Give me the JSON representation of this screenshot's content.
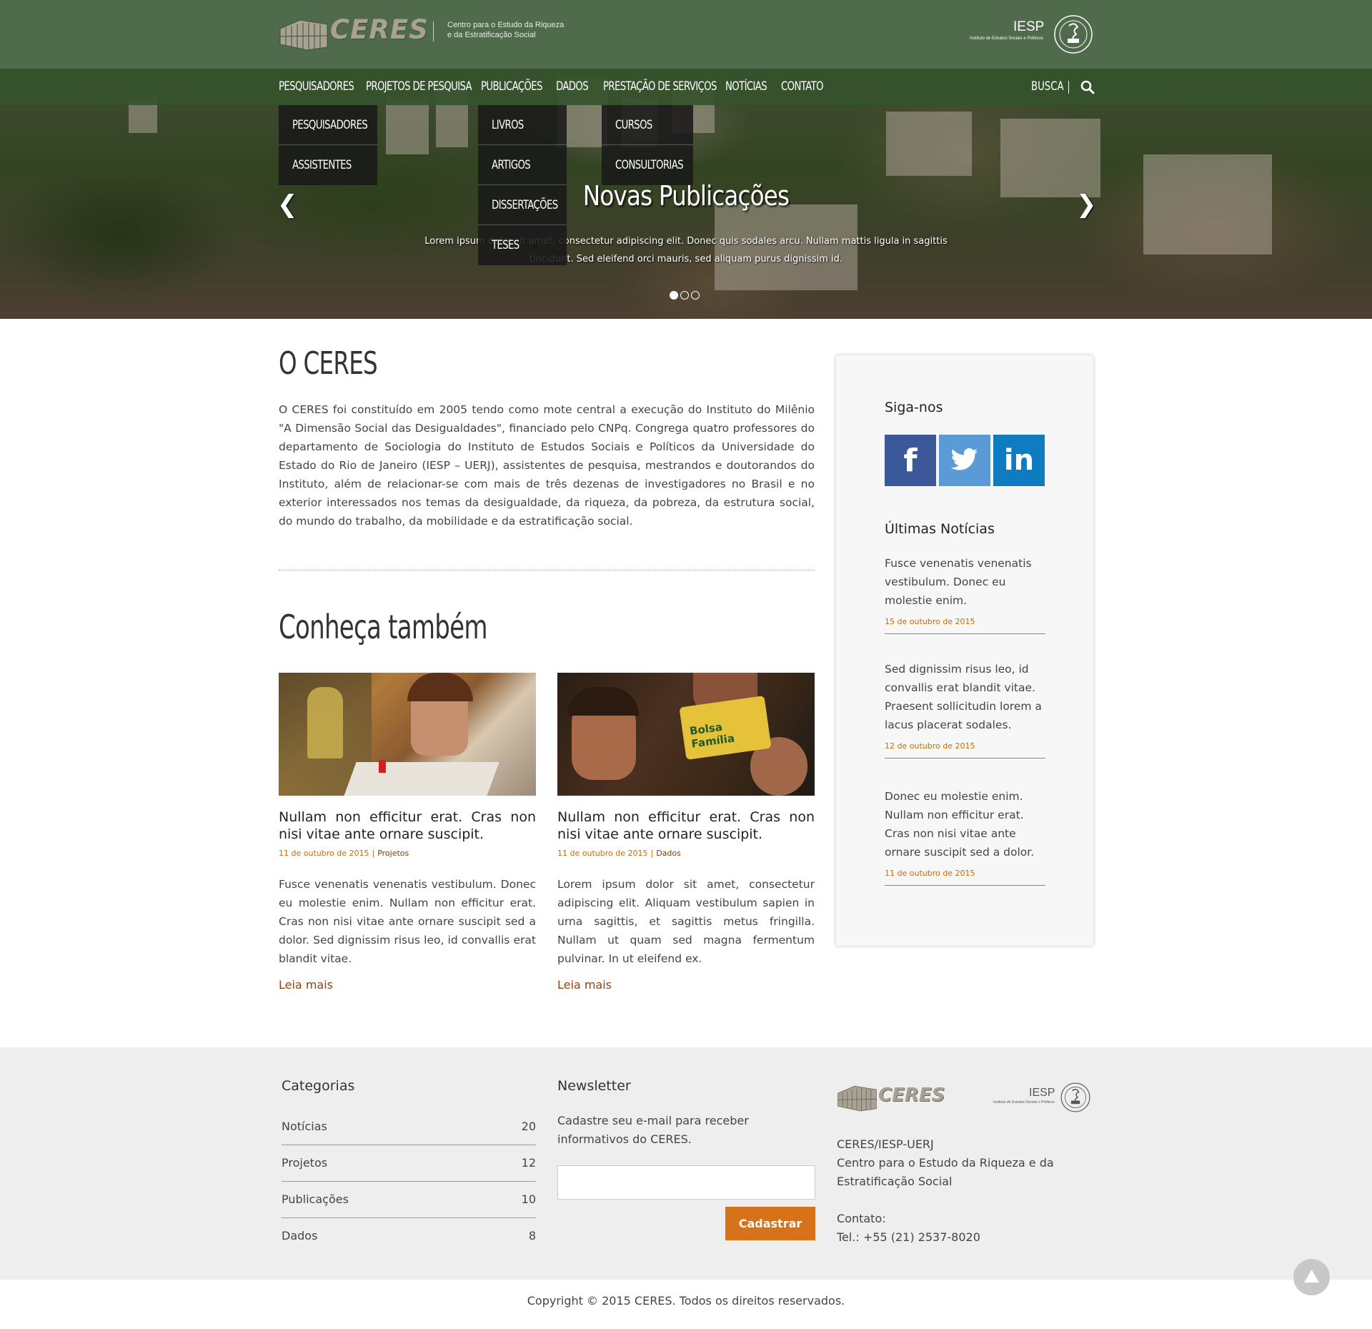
{
  "header": {
    "brand": "CERES",
    "tagline_line1": "Centro para o Estudo da Riqueza",
    "tagline_line2": "e da Estratificação Social",
    "partner_name": "IESP",
    "partner_sub": "Instituto de Estudos Sociais e Políticos"
  },
  "nav": {
    "items": [
      "PESQUISADORES",
      "PROJETOS DE PESQUISA",
      "PUBLICAÇÕES",
      "DADOS",
      "PRESTAÇÃO DE SERVIÇOS",
      "NOTÍCIAS",
      "CONTATO"
    ],
    "search_label": "BUSCA",
    "dropdowns": {
      "pesquisadores": [
        "PESQUISADORES",
        "ASSISTENTES"
      ],
      "publicacoes": [
        "LIVROS",
        "ARTIGOS",
        "DISSERTAÇÕES",
        "TESES"
      ],
      "servicos": [
        "CURSOS",
        "CONSULTORIAS"
      ]
    }
  },
  "hero": {
    "title": "Novas Publicações",
    "text": "Lorem ipsum dolor sit amet, consectetur adipiscing elit. Donec quis sodales arcu. Nullam mattis ligula in sagittis tincidunt. Sed eleifend orci mauris, sed aliquam purus dignissim id.",
    "slides": 3,
    "active_slide": 1
  },
  "about": {
    "title": "O CERES",
    "text": "O CERES foi constituído em 2005 tendo como mote central a execução do Instituto do Milênio \"A Dimensão Social das Desigualdades\", financiado pelo CNPq. Congrega quatro professores do departamento de Sociologia do Instituto de Estudos Sociais e Políticos da Universidade do Estado do Rio de Janeiro (IESP – UERJ), assistentes de pesquisa, mestrandos e doutorandos do Instituto, além de relacionar-se com mais de três dezenas de investigadores no Brasil e no exterior interessados nos temas da desigualdade, da riqueza, da pobreza, da estrutura social, do mundo do trabalho, da mobilidade e da estratificação social."
  },
  "related": {
    "title": "Conheça também",
    "cards": [
      {
        "title": "Nullam non efficitur erat. Cras non nisi vitae ante ornare suscipit.",
        "date": "11 de outubro de 2015",
        "category": "Projetos",
        "text": "Fusce venenatis venenatis vestibulum. Donec eu molestie enim. Nullam non efficitur erat. Cras non nisi vitae ante ornare suscipit sed a dolor. Sed dignissim risus leo, id convallis erat blandit vitae.",
        "link": "Leia mais"
      },
      {
        "title": "Nullam non efficitur erat. Cras non nisi vitae ante ornare suscipit.",
        "date": "11 de outubro de 2015",
        "category": "Dados",
        "text": "Lorem ipsum dolor sit amet, consectetur adipiscing elit. Aliquam vestibulum sapien in urna sagittis, et sagittis metus fringilla. Nullam ut quam sed magna fermentum pulvinar. In ut eleifend ex.",
        "link": "Leia mais",
        "card_text": "Bolsa Família"
      }
    ]
  },
  "sidebar": {
    "follow_title": "Siga-nos",
    "social": [
      "facebook",
      "twitter",
      "linkedin"
    ],
    "news_title": "Últimas Notícias",
    "news": [
      {
        "text": "Fusce venenatis venenatis vestibulum. Donec eu molestie enim.",
        "date": "15 de outubro de 2015"
      },
      {
        "text": "Sed dignissim risus leo, id convallis erat blandit vitae. Praesent sollicitudin lorem a lacus placerat sodales.",
        "date": "12 de outubro de 2015"
      },
      {
        "text": "Donec eu molestie enim. Nullam non efficitur erat. Cras non nisi vitae ante ornare suscipit sed a dolor.",
        "date": "11 de outubro de 2015"
      }
    ]
  },
  "footer": {
    "categories_title": "Categorias",
    "categories": [
      {
        "label": "Notícias",
        "count": "20"
      },
      {
        "label": "Projetos",
        "count": "12"
      },
      {
        "label": "Publicações",
        "count": "10"
      },
      {
        "label": "Dados",
        "count": "8"
      }
    ],
    "newsletter_title": "Newsletter",
    "newsletter_text": "Cadastre seu e-mail para receber informativos do CERES.",
    "newsletter_button": "Cadastrar",
    "info_line1": "CERES/IESP-UERJ",
    "info_line2": "Centro para o Estudo da Riqueza e da Estratificação Social",
    "contact_label": "Contato:",
    "phone": "Tel.: +55 (21) 2537-8020",
    "brand": "CERES",
    "partner_name": "IESP",
    "partner_sub": "Instituto de Estudos Sociais e Políticos"
  },
  "copyright": "Copyright © 2015 CERES. Todos os direitos reservados.",
  "colors": {
    "header_green": "#4f6b4c",
    "nav_green": "#34522d",
    "accent_orange": "#d6731a",
    "date_orange": "#c76c06"
  }
}
